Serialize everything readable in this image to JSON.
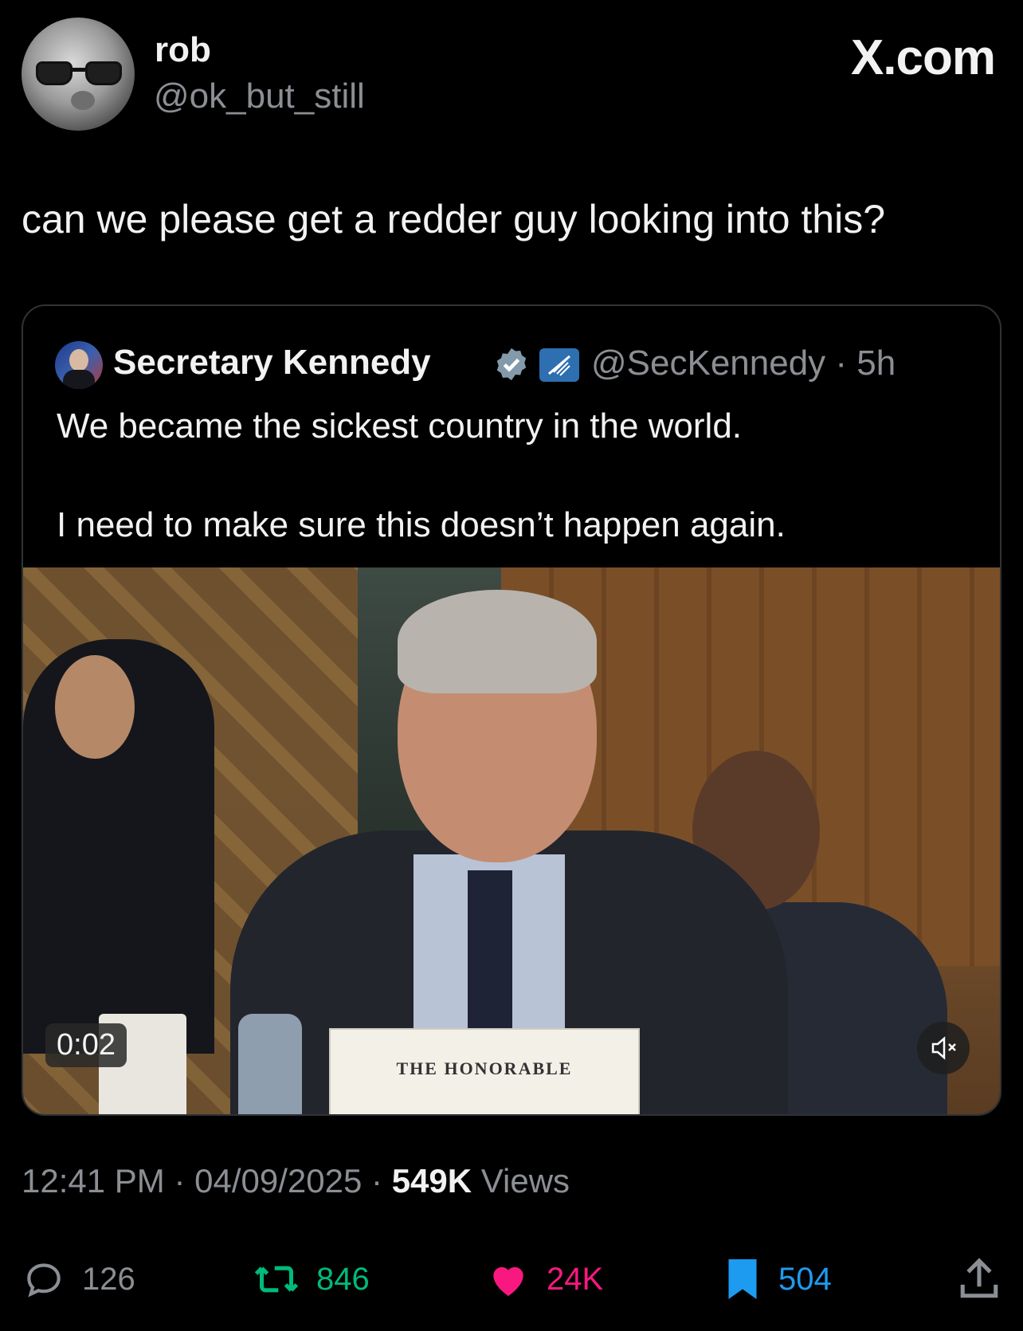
{
  "header": {
    "name": "rob",
    "handle": "@ok_but_still",
    "brand": "X.com"
  },
  "tweet": {
    "text": "can we please get a redder guy looking into this?"
  },
  "quote": {
    "name": "Secretary Kennedy",
    "handle_time": "@SecKennedy · 5h",
    "line1": "We became the sickest country in the world.",
    "line2": "I need to make sure this doesn’t happen again.",
    "video": {
      "timer": "0:02",
      "placard": "THE HONORABLE"
    }
  },
  "meta": {
    "time": "12:41 PM",
    "date": "04/09/2025",
    "views_count": "549K",
    "views_label": "Views",
    "sep": "·"
  },
  "actions": {
    "replies": "126",
    "reposts": "846",
    "likes": "24K",
    "bookmarks": "504"
  },
  "colors": {
    "background": "#000000",
    "repost": "#00ba7c",
    "like": "#f91880",
    "bookmark": "#1d9bf0",
    "muted": "#8b8f94"
  },
  "icons": [
    "reply-icon",
    "repost-icon",
    "like-icon",
    "bookmark-icon",
    "share-icon",
    "verified-icon",
    "mute-icon"
  ]
}
